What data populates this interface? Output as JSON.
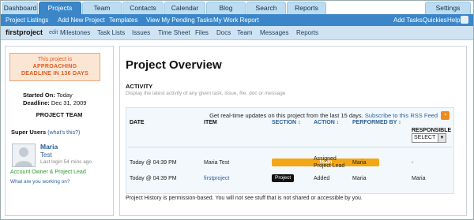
{
  "tabs": [
    "Dashboard",
    "Projects",
    "Team",
    "Contacts",
    "Calendar",
    "Blog",
    "Search",
    "Reports",
    "Settings"
  ],
  "subnav": {
    "left": [
      "Project Listings",
      "Add New Project",
      "Templates",
      "View My Pending Tasks",
      "My Work Report"
    ],
    "right": [
      "Add Tasks",
      "Quickies",
      "Help"
    ],
    "tags_icon": "tag-icon"
  },
  "project": {
    "name": "firstproject",
    "edit_label": "edit",
    "menu": [
      "Milestones",
      "Task Lists",
      "Issues",
      "Time Sheet",
      "Files",
      "Docs",
      "Team",
      "Messages",
      "Reports"
    ]
  },
  "sidebar": {
    "approach_line1": "This project is",
    "approach_line2": "APPROACHING",
    "approach_line3": "DEADLINE IN 136 DAYS",
    "started_label": "Started On:",
    "started_value": "Today",
    "deadline_label": "Deadline:",
    "deadline_value": "Dec 31, 2009",
    "team_heading": "PROJECT TEAM",
    "super_users_label": "Super Users",
    "whats_this": "(what's this?)",
    "user": {
      "first_name": "Maria",
      "last_name": "Test",
      "last_login": "Last login 54 mins ago",
      "role": "Account Owner & Project Lead",
      "working_on": "What are you working on?"
    }
  },
  "main": {
    "title": "Project Overview",
    "activity_heading": "ACTIVITY",
    "activity_desc": "Display the latest activity of any given task, issue, file, doc or message",
    "feed_text": "Get real-time updates on this project from the last 15 days.",
    "feed_link": "Subscribe to this RSS Feed",
    "columns": [
      "DATE",
      "ITEM",
      "SECTION",
      "ACTION",
      "PERFORMED BY",
      "RESPONSIBLE"
    ],
    "select_value": "SELECT",
    "rows": [
      {
        "date": "Today @ 04:39 PM",
        "item": "Maria Test",
        "section": "Team",
        "action_line1": "Assigned",
        "action_line2": "Project Lead",
        "performed_by": "Maria",
        "responsible": "-"
      },
      {
        "date": "Today @ 04:39 PM",
        "item": "firstproject",
        "section": "Project",
        "action_line1": "Added",
        "action_line2": "",
        "performed_by": "Maria",
        "responsible": "Maria"
      }
    ],
    "history_note": "Project History is permission-based. You will not see stuff that is not shared or accessible by you."
  },
  "colors": {
    "accent": "#3a86c8",
    "tab": "#bcdcf2",
    "warning": "#e0591f",
    "team_badge": "#f3a716",
    "success": "#2e9a2a"
  }
}
